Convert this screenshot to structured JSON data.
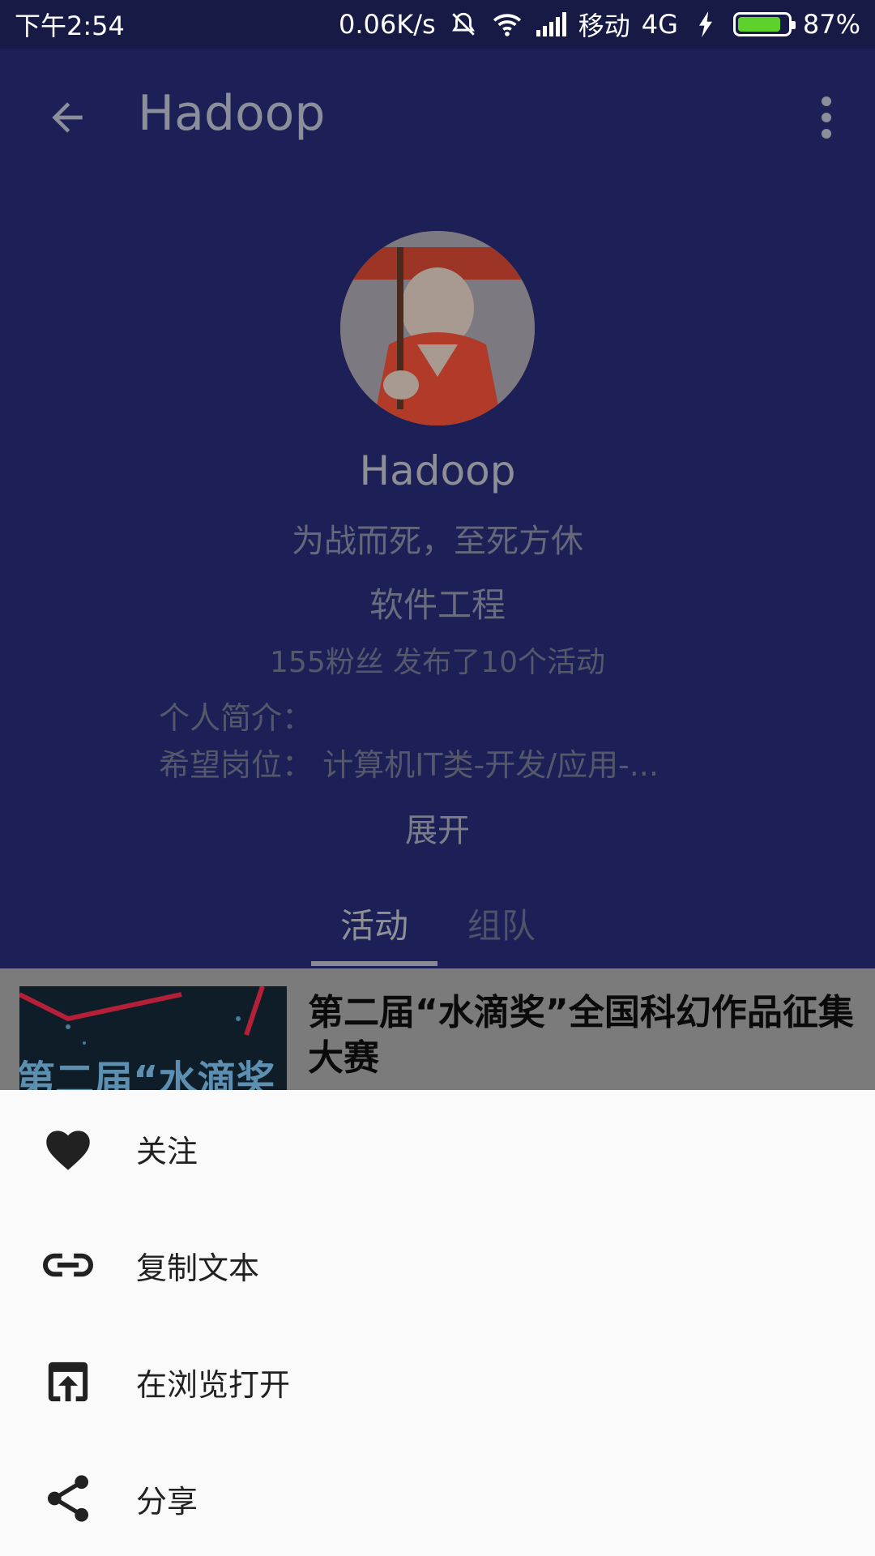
{
  "status_bar": {
    "time": "下午2:54",
    "speed": "0.06K/s",
    "carrier": "移动",
    "network": "4G",
    "battery": "87%",
    "battery_level": 0.87
  },
  "app_bar": {
    "title": "Hadoop"
  },
  "profile": {
    "name": "Hadoop",
    "motto": "为战而死，至死方休",
    "major": "软件工程",
    "stats": "155粉丝 发布了10个活动",
    "intro_label": "个人简介：",
    "job_line": "希望岗位：  计算机IT类-开发/应用-...",
    "expand_label": "展开"
  },
  "tabs": [
    {
      "label": "活动",
      "active": true
    },
    {
      "label": "组队",
      "active": false
    }
  ],
  "list": [
    {
      "title": "第二届“水滴奖”全国科幻作品征集大赛",
      "thumb_text": "第二届“水滴奖"
    }
  ],
  "sheet": {
    "items": [
      {
        "label": "关注",
        "icon": "heart-icon"
      },
      {
        "label": "复制文本",
        "icon": "link-icon"
      },
      {
        "label": "在浏览打开",
        "icon": "open-in-browser-icon"
      },
      {
        "label": "分享",
        "icon": "share-icon"
      }
    ]
  },
  "colors": {
    "primary_dimmed": "#1c2056",
    "sheet_bg": "#fafafa",
    "battery_fill": "#5fd12b"
  }
}
